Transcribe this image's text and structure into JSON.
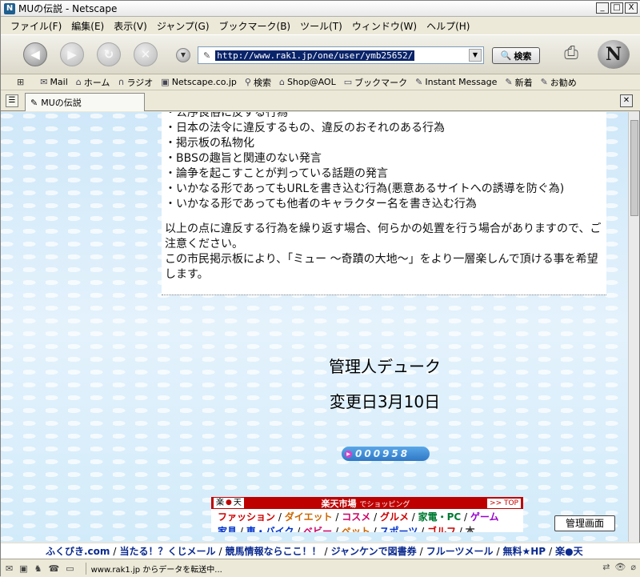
{
  "window": {
    "title": "MUの伝説 - Netscape",
    "app_icon": "N",
    "minimize": "_",
    "maximize": "□",
    "close": "X"
  },
  "menu": [
    "ファイル(F)",
    "編集(E)",
    "表示(V)",
    "ジャンプ(G)",
    "ブックマーク(B)",
    "ツール(T)",
    "ウィンドウ(W)",
    "ヘルプ(H)"
  ],
  "nav": {
    "url": "http://www.rak1.jp/one/user/ymb25652/",
    "search_label": "検索",
    "logo": "N"
  },
  "personal_toolbar": {
    "items": [
      "Mail",
      "ホーム",
      "ラジオ",
      "Netscape.co.jp",
      "検索",
      "Shop@AOL",
      "ブックマーク",
      "Instant Message",
      "新着",
      "お勧め"
    ]
  },
  "tab": {
    "title": "MUの伝説"
  },
  "rules": {
    "partial_first": "・公序良俗に反する行為",
    "items": [
      "・日本の法令に違反するもの、違反のおそれのある行為",
      "・掲示板の私物化",
      "・BBSの趣旨と関連のない発言",
      "・論争を起こすことが判っている話題の発言",
      "・いかなる形であってもURLを書き込む行為(悪意あるサイトへの誘導を防ぐ為)",
      "・いかなる形であっても他者のキャラクター名を書き込む行為"
    ],
    "warning": "以上の点に違反する行為を繰り返す場合、何らかの処置を行う場合がありますので、ご注意ください。",
    "closing": "この市民掲示板により、「ミュー ～奇蹟の大地～」をより一層楽しんで頂ける事を希望します。"
  },
  "admin_name": "管理人デューク",
  "change_date": "変更日3月10日",
  "counter": "000958",
  "rakuten_banner": {
    "logo_left": "楽",
    "logo_dot": "●",
    "logo_right": "天",
    "center": "楽天市場",
    "center_sub": "でショッピング",
    "top_link": ">> TOP",
    "row1": [
      "ファッション",
      "ダイエット",
      "コスメ",
      "グルメ",
      "家電・PC",
      "ゲーム"
    ],
    "row2": [
      "家具",
      "車・バイク",
      "ベビー",
      "ペット",
      "スポーツ",
      "ゴルフ",
      "本"
    ]
  },
  "admin_button": "管理画面",
  "linkbar": {
    "items": [
      "ふくびき.com",
      "当たる！？くじメール",
      "競馬情報ならここ！！",
      "ジャンケンで図書券",
      "フルーツメール",
      "無料★HP",
      "楽●天"
    ]
  },
  "status": {
    "text": "www.rak1.jp からデータを転送中..."
  },
  "colors": {
    "accent_red": "#bf0000",
    "link_blue": "#0b2a8f",
    "url_highlight": "#0a246a"
  }
}
